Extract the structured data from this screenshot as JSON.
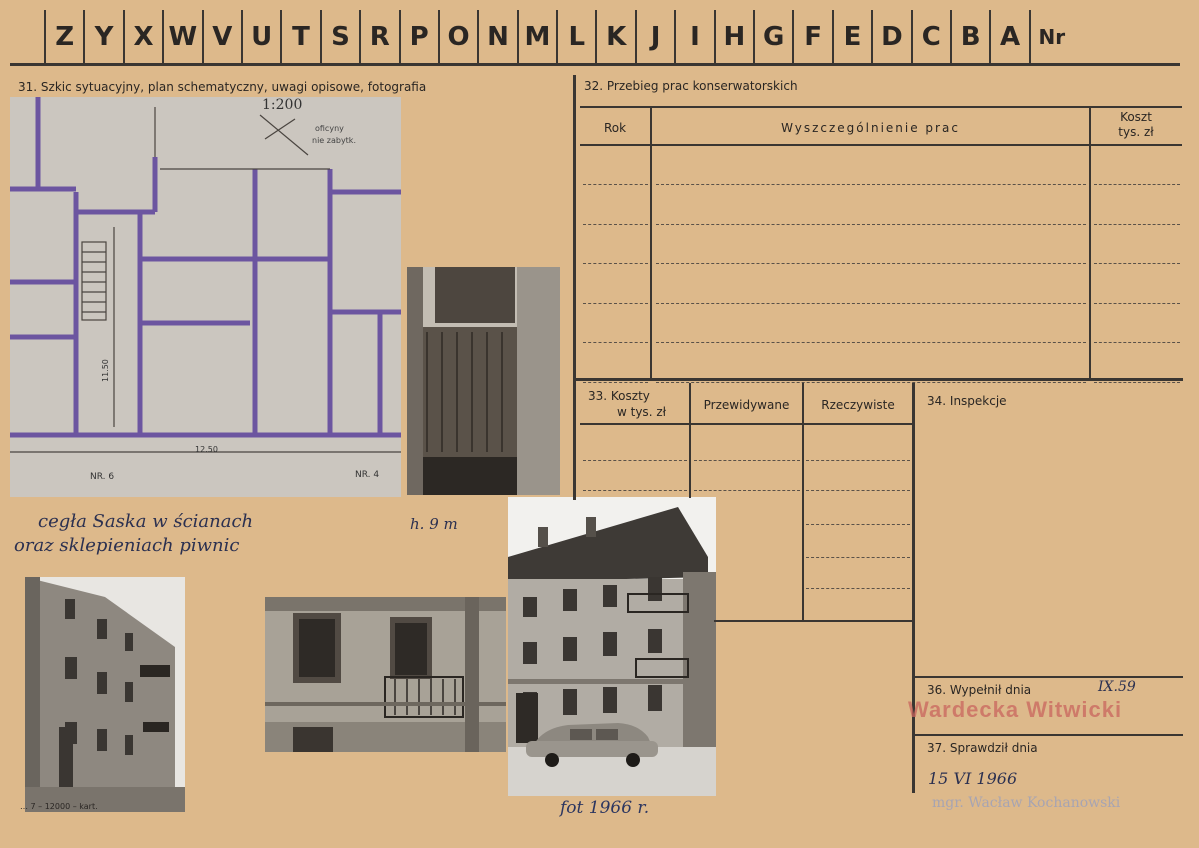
{
  "header": {
    "letters": [
      "Z",
      "Y",
      "X",
      "W",
      "V",
      "U",
      "T",
      "S",
      "R",
      "P",
      "O",
      "N",
      "M",
      "L",
      "K",
      "J",
      "I",
      "H",
      "G",
      "F",
      "E",
      "D",
      "C",
      "B",
      "A"
    ],
    "nr_label": "Nr"
  },
  "section31": {
    "title": "31. Szkic sytuacyjny, plan schematyczny, uwagi opisowe, fotografia",
    "plan_scale": "1:200",
    "plan_note": "oficyny nie zabytk.",
    "plan_dimension_width": "12.50",
    "plan_dimension_height": "11.50",
    "plan_label_left": "NR. 6",
    "plan_label_right": "NR. 4",
    "handwritten_note_line1": "cegła Saska w ścianach",
    "handwritten_note_line2": "oraz sklepieniach piwnic",
    "handwritten_height": "h. 9 m",
    "photo_date_note": "fot 1966 r.",
    "printer_footer": "… 7 – 12000 – kart."
  },
  "section32": {
    "title": "32. Przebieg prac konserwatorskich",
    "col_year": "Rok",
    "col_works": "Wyszczególnienie prac",
    "col_cost": "Koszt",
    "col_cost_unit": "tys. zł"
  },
  "section33": {
    "title_line1": "33. Koszty",
    "title_line2": "w tys. zł",
    "col_planned": "Przewidywane",
    "col_actual": "Rzeczywiste"
  },
  "section34": {
    "title": "34. Inspekcje"
  },
  "section36": {
    "title": "36. Wypełnił dnia",
    "date": "IX.59",
    "stamp_name": "Wardecka Witwicki"
  },
  "section37": {
    "title": "37. Sprawdził dnia",
    "date": "15 VI 1966",
    "checker": "mgr. Wacław Kochanowski"
  }
}
